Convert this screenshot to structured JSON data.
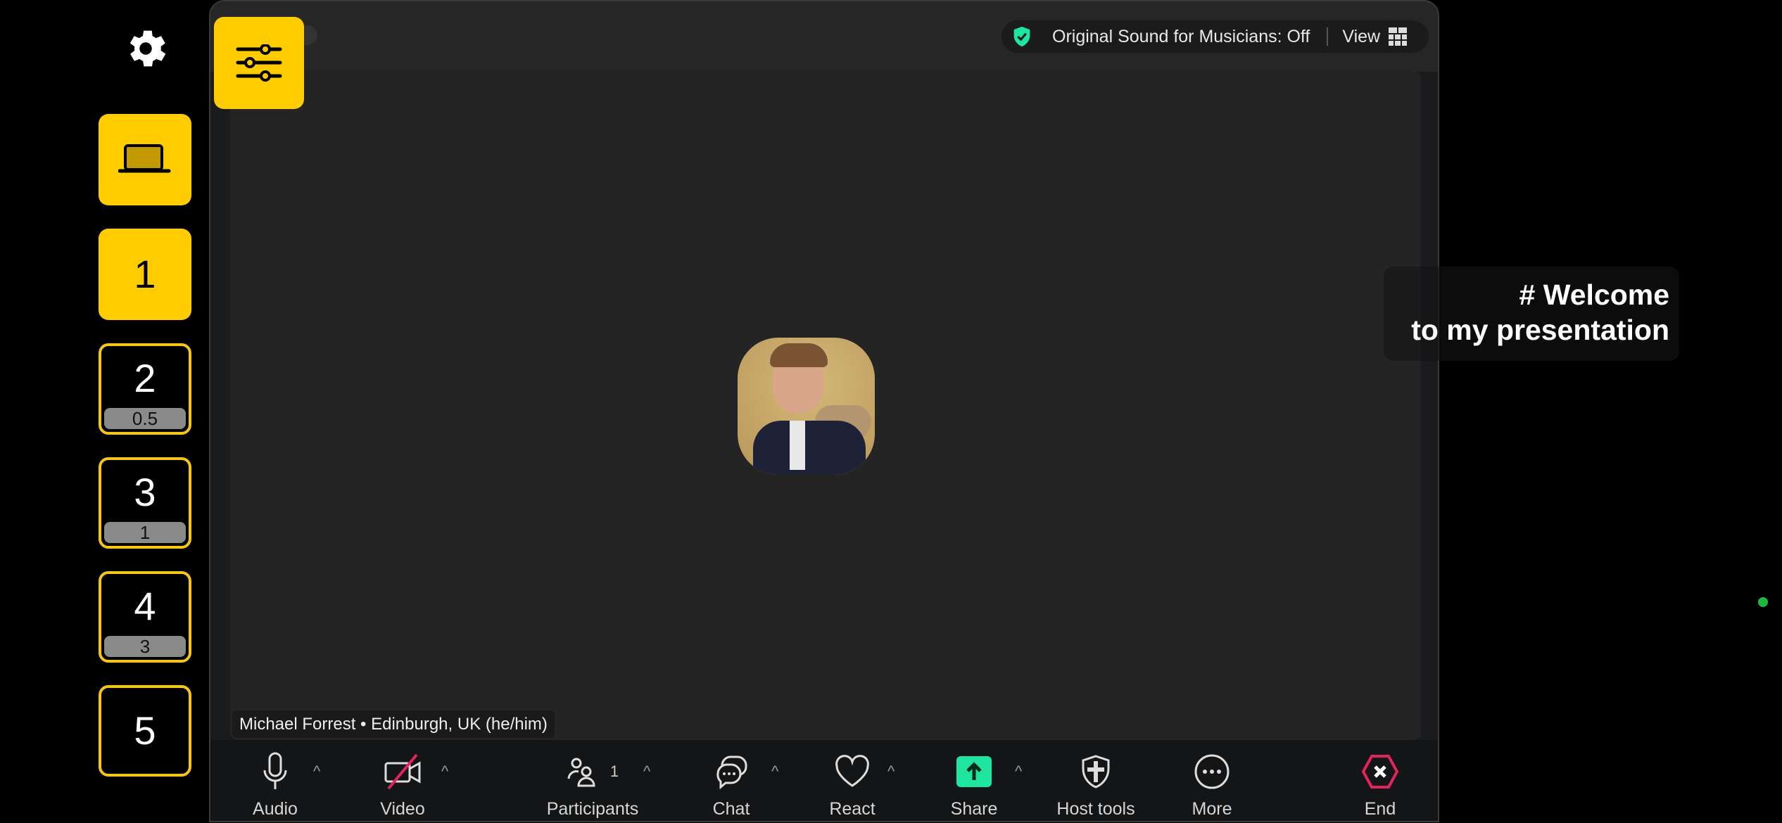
{
  "sidebar": {
    "settings_icon": "gear-icon",
    "laptop_icon": "laptop-icon",
    "slides": [
      {
        "number": "1",
        "badge": null
      },
      {
        "number": "2",
        "badge": "0.5"
      },
      {
        "number": "3",
        "badge": "1"
      },
      {
        "number": "4",
        "badge": "3"
      },
      {
        "number": "5",
        "badge": null
      }
    ]
  },
  "colors": {
    "accent": "#ffcc00",
    "share_green": "#1ee6a0",
    "end_red": "#e0245e",
    "shield_green": "#1ee6a0"
  },
  "meeting": {
    "original_sound": "Original Sound for Musicians: Off",
    "view_label": "View",
    "participant_name": "Michael Forrest • Edinburgh, UK (he/him)"
  },
  "toolbar": {
    "audio": "Audio",
    "video": "Video",
    "participants": "Participants",
    "participants_count": "1",
    "chat": "Chat",
    "react": "React",
    "share": "Share",
    "host_tools": "Host tools",
    "more": "More",
    "end": "End"
  },
  "overlay": {
    "line1": "# Welcome",
    "line2": "to my presentation"
  }
}
